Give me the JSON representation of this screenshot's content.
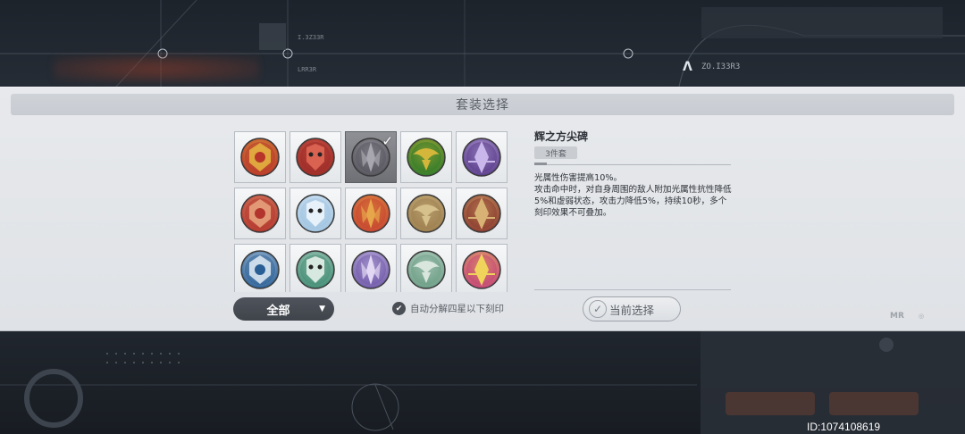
{
  "modal": {
    "title": "套装选择",
    "filter_label": "全部",
    "auto_decompose_label": "自动分解四星以下刻印",
    "current_select_label": "当前选择"
  },
  "detail": {
    "name": "辉之方尖碑",
    "set_count": "3件套",
    "description": [
      "光属性伤害提高10%。",
      "攻击命中时，对自身周围的敌人附加光属性抗性降低5%和虚弱状态，攻击力降低5%，持续10秒，多个刻印效果不可叠加。"
    ]
  },
  "sets": [
    {
      "icon": "lion-crest-icon",
      "color": "#b8352a",
      "accent": "#e2b040",
      "selected": false
    },
    {
      "icon": "red-oni-mask-icon",
      "color": "#9b2a26",
      "accent": "#d96250",
      "selected": false
    },
    {
      "icon": "obelisk-shards-icon",
      "color": "#55535c",
      "accent": "#a8a6ae",
      "selected": true
    },
    {
      "icon": "green-phoenix-icon",
      "color": "#2e7a2a",
      "accent": "#d4b73a",
      "selected": false
    },
    {
      "icon": "purple-crystal-icon",
      "color": "#5a3c8a",
      "accent": "#c9b6ea",
      "selected": false
    },
    {
      "icon": "red-wing-emblem-icon",
      "color": "#b2342c",
      "accent": "#e6a07a",
      "selected": false
    },
    {
      "icon": "ice-lotus-icon",
      "color": "#9fc3e0",
      "accent": "#e6f1fa",
      "selected": false
    },
    {
      "icon": "flame-spiral-icon",
      "color": "#c64430",
      "accent": "#e7a64a",
      "selected": false
    },
    {
      "icon": "golden-cross-icon",
      "color": "#9c7e4e",
      "accent": "#d6c08c",
      "selected": false
    },
    {
      "icon": "ornate-shield-icon",
      "color": "#8b3b2e",
      "accent": "#d8b274",
      "selected": false
    },
    {
      "icon": "blue-dragon-icon",
      "color": "#2a5f95",
      "accent": "#d8e4ef",
      "selected": false
    },
    {
      "icon": "green-horns-icon",
      "color": "#3f8a72",
      "accent": "#d6e8df",
      "selected": false
    },
    {
      "icon": "violet-demon-icon",
      "color": "#6e58a8",
      "accent": "#e2d8f4",
      "selected": false
    },
    {
      "icon": "jade-infinity-icon",
      "color": "#6a9c84",
      "accent": "#d8e6de",
      "selected": false
    },
    {
      "icon": "pink-chalice-icon",
      "color": "#c2427a",
      "accent": "#f0d35a",
      "selected": false
    }
  ],
  "watermark": {
    "id_text": "ID:1074108619"
  },
  "background": {
    "code_1": "ZO.I33R3",
    "code_2": "I.3Z33R",
    "code_3": "LRR3R"
  }
}
